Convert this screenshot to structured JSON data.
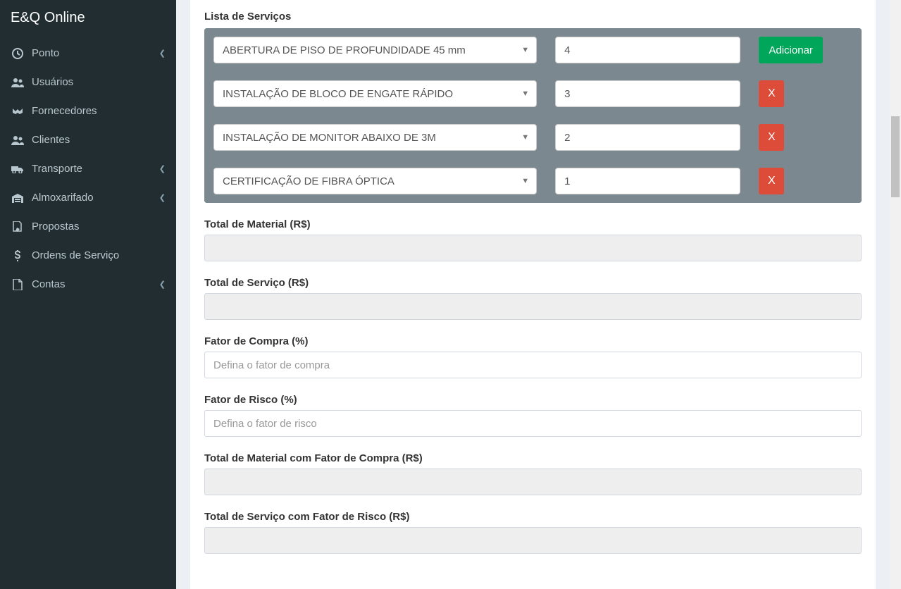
{
  "brand": "E&Q Online",
  "sidebar": {
    "items": [
      {
        "label": "Ponto",
        "chevron": true,
        "icon": "clock"
      },
      {
        "label": "Usuários",
        "chevron": false,
        "icon": "users"
      },
      {
        "label": "Fornecedores",
        "chevron": false,
        "icon": "handshake"
      },
      {
        "label": "Clientes",
        "chevron": false,
        "icon": "users"
      },
      {
        "label": "Transporte",
        "chevron": true,
        "icon": "truck"
      },
      {
        "label": "Almoxarifado",
        "chevron": true,
        "icon": "warehouse"
      },
      {
        "label": "Propostas",
        "chevron": false,
        "icon": "file-signature"
      },
      {
        "label": "Ordens de Serviço",
        "chevron": false,
        "icon": "dollar"
      },
      {
        "label": "Contas",
        "chevron": true,
        "icon": "file"
      }
    ]
  },
  "main": {
    "services_title": "Lista de Serviços",
    "add_button": "Adicionar",
    "remove_button": "X",
    "rows": [
      {
        "service": "ABERTURA DE PISO DE PROFUNDIDADE 45 mm",
        "qty": "4",
        "action": "add"
      },
      {
        "service": "INSTALAÇÃO DE BLOCO DE ENGATE RÁPIDO",
        "qty": "3",
        "action": "remove"
      },
      {
        "service": "INSTALAÇÃO DE MONITOR ABAIXO DE 3M",
        "qty": "2",
        "action": "remove"
      },
      {
        "service": "CERTIFICAÇÃO DE FIBRA ÓPTICA",
        "qty": "1",
        "action": "remove"
      }
    ],
    "fields": {
      "total_material_label": "Total de Material (R$)",
      "total_servico_label": "Total de Serviço (R$)",
      "fator_compra_label": "Fator de Compra (%)",
      "fator_compra_placeholder": "Defina o fator de compra",
      "fator_risco_label": "Fator de Risco (%)",
      "fator_risco_placeholder": "Defina o fator de risco",
      "total_material_fator_label": "Total de Material com Fator de Compra (R$)",
      "total_servico_fator_label": "Total de Serviço com Fator de Risco (R$)"
    }
  }
}
